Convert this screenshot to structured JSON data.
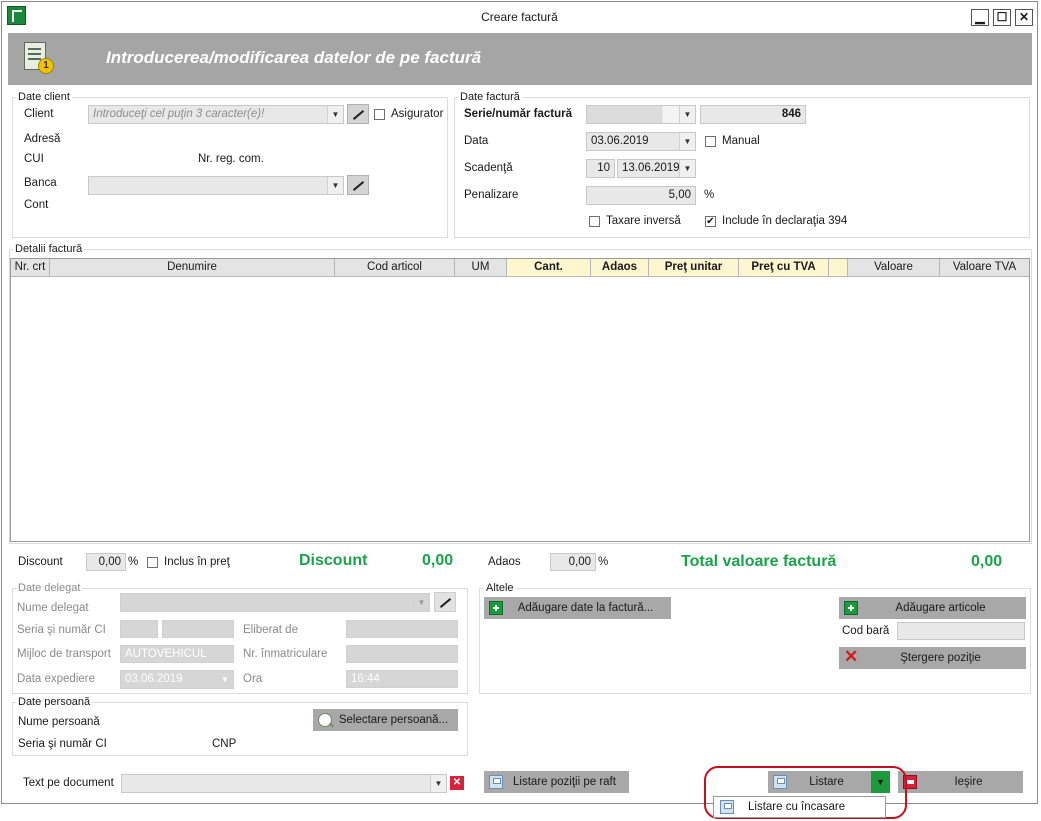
{
  "window": {
    "title": "Creare factură",
    "min_glyph": "▁",
    "max_glyph": "☐",
    "close_glyph": "✕",
    "app_icon": "app-logo-icon"
  },
  "banner": {
    "title": "Introducerea/modificarea datelor de pe factură",
    "icon": "document-number-icon",
    "badge": "1"
  },
  "client": {
    "group_title": "Date client",
    "client_label": "Client",
    "client_placeholder": "Introduceţi cel puţin 3 caracter(e)!",
    "asigurator_label": "Asigurator",
    "adresa_label": "Adresă",
    "cui_label": "CUI",
    "nr_reg_label": "Nr. reg. com.",
    "banca_label": "Banca",
    "cont_label": "Cont"
  },
  "invoice": {
    "group_title": "Date factură",
    "serie_label": "Serie/număr factură",
    "serie_value": "",
    "numar_value": "846",
    "data_label": "Data",
    "data_value": "03.06.2019",
    "manual_label": "Manual",
    "scadenta_label": "Scadenţă",
    "scadenta_days": "10",
    "scadenta_date": "13.06.2019",
    "penalizare_label": "Penalizare",
    "penalizare_value": "5,00",
    "percent": "%",
    "taxare_label": "Taxare inversă",
    "declaratie_label": "Include în declaraţia 394",
    "declaratie_checked": "✔"
  },
  "details": {
    "group_title": "Detalii factură",
    "columns": [
      "Nr. crt",
      "Denumire",
      "Cod articol",
      "UM",
      "Cant.",
      "Adaos",
      "Preţ unitar",
      "Preţ cu TVA",
      "",
      "Valoare",
      "Valoare TVA"
    ]
  },
  "totals": {
    "discount_label": "Discount",
    "discount_value": "0,00",
    "percent": "%",
    "inclus_label": "Inclus în preţ",
    "discount_big_label": "Discount",
    "discount_big_value": "0,00",
    "adaos_label": "Adaos",
    "adaos_value": "0,00",
    "total_label": "Total valoare factură",
    "total_value": "0,00"
  },
  "delegate": {
    "group_title": "Date delegat",
    "nume_label": "Nume delegat",
    "seria_label": "Seria şi număr CI",
    "eliberat_label": "Eliberat de",
    "mijloc_label": "Mijloc de transport",
    "mijloc_value": "AUTOVEHICUL",
    "nr_inmat_label": "Nr. înmatriculare",
    "data_exp_label": "Data expediere",
    "data_exp_value": "03.06.2019",
    "ora_label": "Ora",
    "ora_value": "16:44"
  },
  "person": {
    "group_title": "Date persoană",
    "nume_label": "Nume persoană",
    "seria_label": "Seria şi număr CI",
    "cnp_label": "CNP",
    "select_button": "Selectare persoană..."
  },
  "other": {
    "group_title": "Altele",
    "add_data_button": "Adăugare date la factură...",
    "add_articles_button": "Adăugare articole",
    "barcode_label": "Cod bară",
    "delete_button": "Ştergere poziţie"
  },
  "footer": {
    "text_doc_label": "Text pe document",
    "list_raft_button": "Listare poziţii pe raft",
    "listare_button": "Listare",
    "iesire_button": "Ieşire",
    "popup_item": "Listare cu încasare"
  }
}
